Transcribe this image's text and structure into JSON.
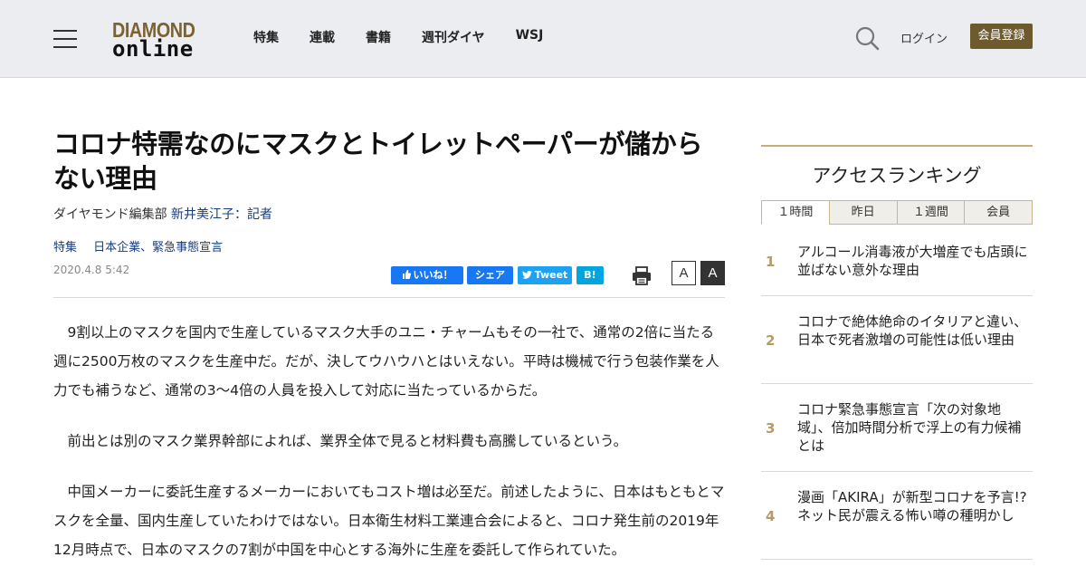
{
  "header": {
    "logo_top": "DIAMOND",
    "logo_bottom": "online",
    "nav": [
      "特集",
      "連載",
      "書籍",
      "週刊ダイヤ",
      "WSJ"
    ],
    "login": "ログイン",
    "register": "会員登録"
  },
  "article": {
    "title": "コロナ特需なのにマスクとトイレットペーパーが儲からない理由",
    "byline_prefix": "ダイヤモンド編集部 ",
    "byline_author": "新井美江子：記者",
    "tags": [
      "特集",
      "日本企業、緊急事態宣言"
    ],
    "date": "2020.4.8 5:42",
    "share_like": "いいね！",
    "share_fb": "シェア",
    "share_tw": "Tweet",
    "share_hb": "B!",
    "font_small": "A",
    "font_large": "A",
    "paragraphs": [
      "9割以上のマスクを国内で生産しているマスク大手のユニ・チャームもその一社で、通常の2倍に当たる週に2500万枚のマスクを生産中だ。だが、決してウハウハとはいえない。平時は機械で行う包装作業を人力でも補うなど、通常の3～4倍の人員を投入して対応に当たっているからだ。",
      "前出とは別のマスク業界幹部によれば、業界全体で見ると材料費も高騰しているという。",
      "中国メーカーに委託生産するメーカーにおいてもコスト増は必至だ。前述したように、日本はもともとマスクを全量、国内生産していたわけではない。日本衛生材料工業連合会によると、コロナ発生前の2019年12月時点で、日本のマスクの7割が中国を中心とする海外に生産を委託して作られていた。"
    ]
  },
  "sidebar": {
    "heading": "アクセスランキング",
    "tabs": [
      "１時間",
      "昨日",
      "１週間",
      "会員"
    ],
    "items": [
      {
        "rank": "1",
        "text": "アルコール消毒液が大増産でも店頭に並ばない意外な理由"
      },
      {
        "rank": "2",
        "text": "コロナで絶体絶命のイタリアと違い、日本で死者激増の可能性は低い理由"
      },
      {
        "rank": "3",
        "text": "コロナ緊急事態宣言「次の対象地域」、倍加時間分析で浮上の有力候補とは"
      },
      {
        "rank": "4",
        "text": "漫画「AKIRA」が新型コロナを予言!?ネット民が震える怖い噂の種明かし"
      }
    ]
  },
  "colors": {
    "header_bg": "#ebedf0",
    "brand_gold": "#7a6233",
    "register_bg": "#6d5a2d",
    "rank_gold": "#b39c66",
    "link_blue": "#1a3d7c"
  }
}
